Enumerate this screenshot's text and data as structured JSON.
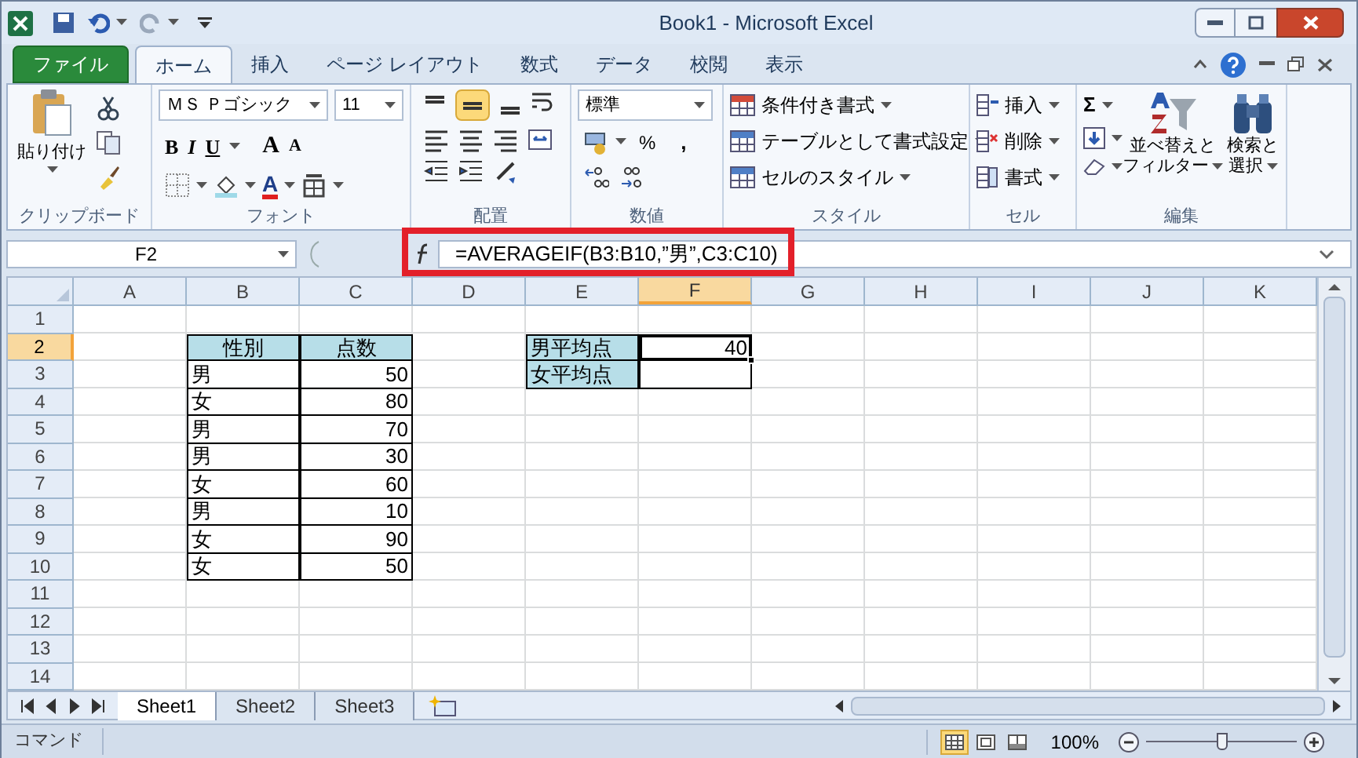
{
  "window": {
    "title": "Book1 - Microsoft Excel"
  },
  "tabs": [
    {
      "label": "ファイル",
      "kind": "file",
      "selected": false
    },
    {
      "label": "ホーム",
      "kind": "tab",
      "selected": true
    },
    {
      "label": "挿入",
      "kind": "tab",
      "selected": false
    },
    {
      "label": "ページ レイアウト",
      "kind": "tab",
      "selected": false
    },
    {
      "label": "数式",
      "kind": "tab",
      "selected": false
    },
    {
      "label": "データ",
      "kind": "tab",
      "selected": false
    },
    {
      "label": "校閲",
      "kind": "tab",
      "selected": false
    },
    {
      "label": "表示",
      "kind": "tab",
      "selected": false
    }
  ],
  "ribbon": {
    "clipboard": {
      "paste": "貼り付け",
      "label": "クリップボード"
    },
    "font": {
      "name": "ＭＳ Ｐゴシック",
      "size": "11",
      "bold": "B",
      "italic": "I",
      "underline": "U",
      "grow": "A",
      "shrink": "A",
      "text_color": "A",
      "label": "フォント"
    },
    "alignment": {
      "valign": [
        {
          "kind": "top",
          "selected": false
        },
        {
          "kind": "middle",
          "selected": true
        },
        {
          "kind": "bottom",
          "selected": false
        }
      ],
      "label": "配置"
    },
    "number": {
      "format": "標準",
      "percent": "%",
      "comma": ",",
      "label": "数値"
    },
    "styles": {
      "items": [
        "条件付き書式",
        "テーブルとして書式設定",
        "セルのスタイル"
      ],
      "label": "スタイル"
    },
    "cells": {
      "items": [
        "挿入",
        "削除",
        "書式"
      ],
      "label": "セル"
    },
    "editing": {
      "sum": "Σ",
      "sort": [
        "並べ替えと",
        "フィルター"
      ],
      "find": [
        "検索と",
        "選択"
      ],
      "label": "編集"
    }
  },
  "formula_bar": {
    "name_box": "F2",
    "formula": "=AVERAGEIF(B3:B10,”男”,C3:C10)",
    "highlighted": true
  },
  "columns": [
    {
      "label": "A",
      "selected": false
    },
    {
      "label": "B",
      "selected": false
    },
    {
      "label": "C",
      "selected": false
    },
    {
      "label": "D",
      "selected": false
    },
    {
      "label": "E",
      "selected": false
    },
    {
      "label": "F",
      "selected": true
    },
    {
      "label": "G",
      "selected": false
    },
    {
      "label": "H",
      "selected": false
    },
    {
      "label": "I",
      "selected": false
    },
    {
      "label": "J",
      "selected": false
    },
    {
      "label": "K",
      "selected": false
    }
  ],
  "rows": [
    {
      "label": "1",
      "selected": false
    },
    {
      "label": "2",
      "selected": true
    },
    {
      "label": "3",
      "selected": false
    },
    {
      "label": "4",
      "selected": false
    },
    {
      "label": "5",
      "selected": false
    },
    {
      "label": "6",
      "selected": false
    },
    {
      "label": "7",
      "selected": false
    },
    {
      "label": "8",
      "selected": false
    },
    {
      "label": "9",
      "selected": false
    },
    {
      "label": "10",
      "selected": false
    },
    {
      "label": "11",
      "selected": false
    },
    {
      "label": "12",
      "selected": false
    },
    {
      "label": "13",
      "selected": false
    },
    {
      "label": "14",
      "selected": false
    }
  ],
  "score_table": {
    "headers": [
      "性別",
      "点数"
    ],
    "rows": [
      [
        "男",
        "50"
      ],
      [
        "女",
        "80"
      ],
      [
        "男",
        "70"
      ],
      [
        "男",
        "30"
      ],
      [
        "女",
        "60"
      ],
      [
        "男",
        "10"
      ],
      [
        "女",
        "90"
      ],
      [
        "女",
        "50"
      ]
    ]
  },
  "summary_table": [
    {
      "label": "男平均点",
      "value": "40",
      "selected": true
    },
    {
      "label": "女平均点",
      "selected": false
    }
  ],
  "sheet_tabs": [
    {
      "label": "Sheet1",
      "selected": true
    },
    {
      "label": "Sheet2",
      "selected": false
    },
    {
      "label": "Sheet3",
      "selected": false
    }
  ],
  "status_bar": {
    "mode": "コマンド",
    "views": [
      {
        "kind": "normal",
        "selected": true
      },
      {
        "kind": "layout",
        "selected": false
      },
      {
        "kind": "pagebreak",
        "selected": false
      }
    ],
    "zoom": "100%",
    "zoom_slider": {
      "level": 0.5
    }
  }
}
